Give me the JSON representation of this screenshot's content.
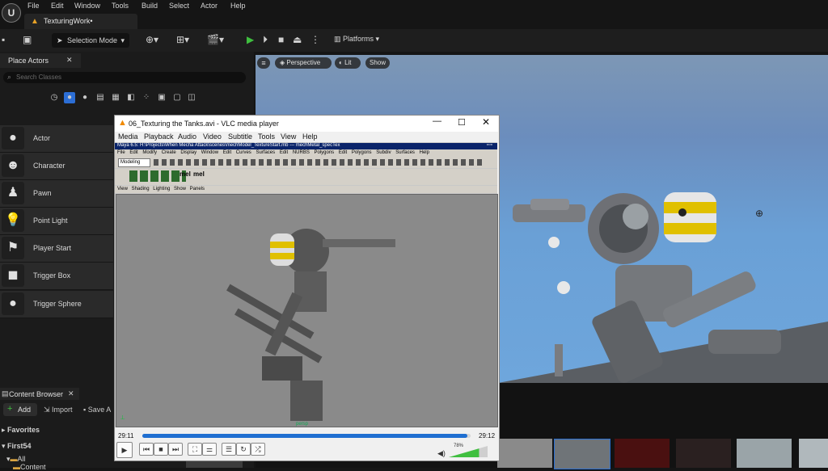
{
  "app": {
    "logo": "U",
    "menu": [
      "File",
      "Edit",
      "Window",
      "Tools",
      "Build",
      "Select",
      "Actor",
      "Help"
    ],
    "document_tab": "TexturingWork•"
  },
  "toolbar": {
    "selection_mode": "Selection Mode",
    "platforms": "Platforms"
  },
  "place_actors": {
    "tab_title": "Place Actors",
    "search_placeholder": "Search Classes",
    "items": [
      {
        "label": "Actor",
        "icon": "sphere-icon"
      },
      {
        "label": "Character",
        "icon": "character-icon"
      },
      {
        "label": "Pawn",
        "icon": "pawn-icon"
      },
      {
        "label": "Point Light",
        "icon": "lightbulb-icon"
      },
      {
        "label": "Player Start",
        "icon": "flag-icon"
      },
      {
        "label": "Trigger Box",
        "icon": "cube-icon"
      },
      {
        "label": "Trigger Sphere",
        "icon": "sphere-icon"
      }
    ]
  },
  "content_browser": {
    "tab_title": "Content Browser",
    "add_label": "Add",
    "import_label": "Import",
    "save_all_label": "Save A",
    "favorites": "Favorites",
    "project": "First54",
    "tree_all": "All",
    "tree_content": "Content"
  },
  "viewport": {
    "perspective": "Perspective",
    "lit": "Lit",
    "show": "Show"
  },
  "vlc": {
    "title": "06_Texturing the Tanks.avi - VLC media player",
    "menu": [
      "Media",
      "Playback",
      "Audio",
      "Video",
      "Subtitle",
      "Tools",
      "View",
      "Help"
    ],
    "time_elapsed": "29:11",
    "time_total": "29:12",
    "progress": 0.99,
    "volume": "78%",
    "volume_level": 0.78
  },
  "maya": {
    "title": "Maya 6.5: H:\\Projects\\When Mecha Attack\\scenes\\mechModel_TextureStart.mb  ---  mechMetal_specTex",
    "menu": [
      "File",
      "Edit",
      "Modify",
      "Create",
      "Display",
      "Window",
      "Edit Curves",
      "Surfaces",
      "Edit NURBS",
      "Polygons",
      "Edit Polygons",
      "Subdiv Surfaces",
      "Help"
    ],
    "mode": "Modeling",
    "shelf_mel_1": "mel",
    "shelf_mel_2": "mel",
    "panel_menu": [
      "View",
      "Shading",
      "Lighting",
      "Show",
      "Panels"
    ],
    "camera_label": "persp"
  },
  "colors": {
    "ue_bg": "#151515",
    "vlc_progress": "#1f6fd1",
    "play_green": "#3fbf3f",
    "hazard_yellow": "#e0c000"
  }
}
